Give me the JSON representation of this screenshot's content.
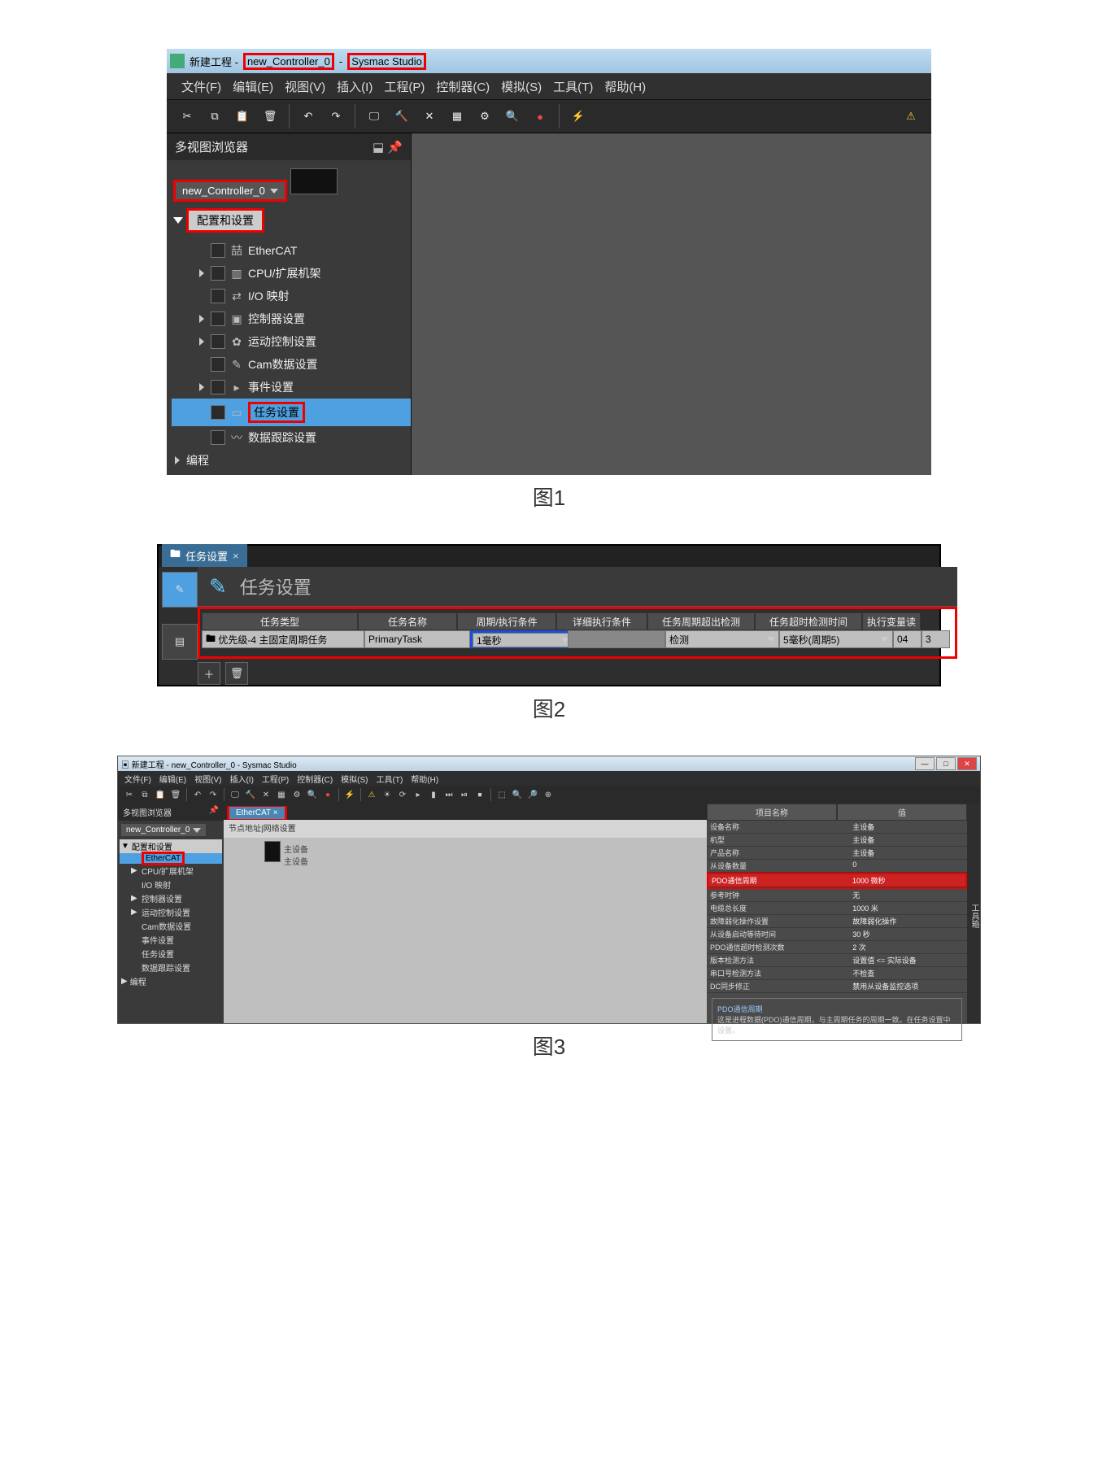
{
  "fig1": {
    "caption": "图1",
    "title_prefix": "新建工程 -",
    "title_ctrl": "new_Controller_0",
    "title_dash": "-",
    "title_app": "Sysmac Studio",
    "menus": [
      "文件(F)",
      "编辑(E)",
      "视图(V)",
      "插入(I)",
      "工程(P)",
      "控制器(C)",
      "模拟(S)",
      "工具(T)",
      "帮助(H)"
    ],
    "panel_title": "多视图浏览器",
    "controller_sel": "new_Controller_0",
    "node_config": "配置和设置",
    "tree": [
      {
        "label": "EtherCAT",
        "arrow": "",
        "icon": "喆"
      },
      {
        "label": "CPU/扩展机架",
        "arrow": "r",
        "icon": "▥"
      },
      {
        "label": "I/O 映射",
        "arrow": "",
        "icon": "⇄"
      },
      {
        "label": "控制器设置",
        "arrow": "r",
        "icon": "▣"
      },
      {
        "label": "运动控制设置",
        "arrow": "r",
        "icon": "✿"
      },
      {
        "label": "Cam数据设置",
        "arrow": "",
        "icon": "✎"
      },
      {
        "label": "事件设置",
        "arrow": "r",
        "icon": "▸"
      },
      {
        "label": "任务设置",
        "arrow": "",
        "icon": "▭",
        "sel": true,
        "red": true
      },
      {
        "label": "数据跟踪设置",
        "arrow": "",
        "icon": "〰"
      }
    ],
    "node_prog": "编程"
  },
  "fig2": {
    "caption": "图2",
    "tab": "任务设置",
    "title": "任务设置",
    "headers": [
      "任务类型",
      "任务名称",
      "周期/执行条件",
      "详细执行条件",
      "任务周期超出检测",
      "任务超时检测时间",
      "执行变量读"
    ],
    "row": {
      "type": "优先级-4 主固定周期任务",
      "name": "PrimaryTask",
      "period": "1毫秒",
      "detail": "",
      "over": "检测",
      "timeout": "5毫秒(周期5)",
      "v1": "04",
      "v2": "3"
    }
  },
  "fig3": {
    "caption": "图3",
    "title": "新建工程 - new_Controller_0 - Sysmac Studio",
    "menus": [
      "文件(F)",
      "编辑(E)",
      "视图(V)",
      "插入(I)",
      "工程(P)",
      "控制器(C)",
      "模拟(S)",
      "工具(T)",
      "帮助(H)"
    ],
    "panel_title": "多视图浏览器",
    "ctrl": "new_Controller_0",
    "cfg": "配置和设置",
    "tree": [
      "EtherCAT",
      "CPU/扩展机架",
      "I/O 映射",
      "控制器设置",
      "运动控制设置",
      "Cam数据设置",
      "事件设置",
      "任务设置",
      "数据跟踪设置"
    ],
    "prog": "编程",
    "tab": "EtherCAT",
    "subheader": "节点地址|网络设置",
    "device_label": "主设备\n主设备",
    "prop_header": {
      "n": "项目名称",
      "v": "值"
    },
    "props": [
      {
        "n": "设备名称",
        "v": "主设备"
      },
      {
        "n": "机型",
        "v": "主设备"
      },
      {
        "n": "产品名称",
        "v": "主设备"
      },
      {
        "n": "从设备数量",
        "v": "0"
      },
      {
        "n": "PDO通信周期",
        "v": "1000                                          微秒",
        "hl": true
      },
      {
        "n": "参考时钟",
        "v": "无"
      },
      {
        "n": "电缆总长度",
        "v": "1000                                          米"
      },
      {
        "n": "故障弱化操作设置",
        "v": "故障弱化操作"
      },
      {
        "n": "从设备启动等待时间",
        "v": "30                                            秒"
      },
      {
        "n": "PDO通信超时检测次数",
        "v": "2                                             次"
      },
      {
        "n": "版本检测方法",
        "v": "设置值 <= 实际设备"
      },
      {
        "n": "串口号检测方法",
        "v": "不检查"
      },
      {
        "n": "DC同步修正",
        "v": "禁用从设备监控选项"
      }
    ],
    "note_title": "PDO通信周期",
    "note_body": "这是进程数据(PDO)通信周期，与主周期任务的周期一致。在任务设置中设置。",
    "side_label": "工具箱"
  }
}
